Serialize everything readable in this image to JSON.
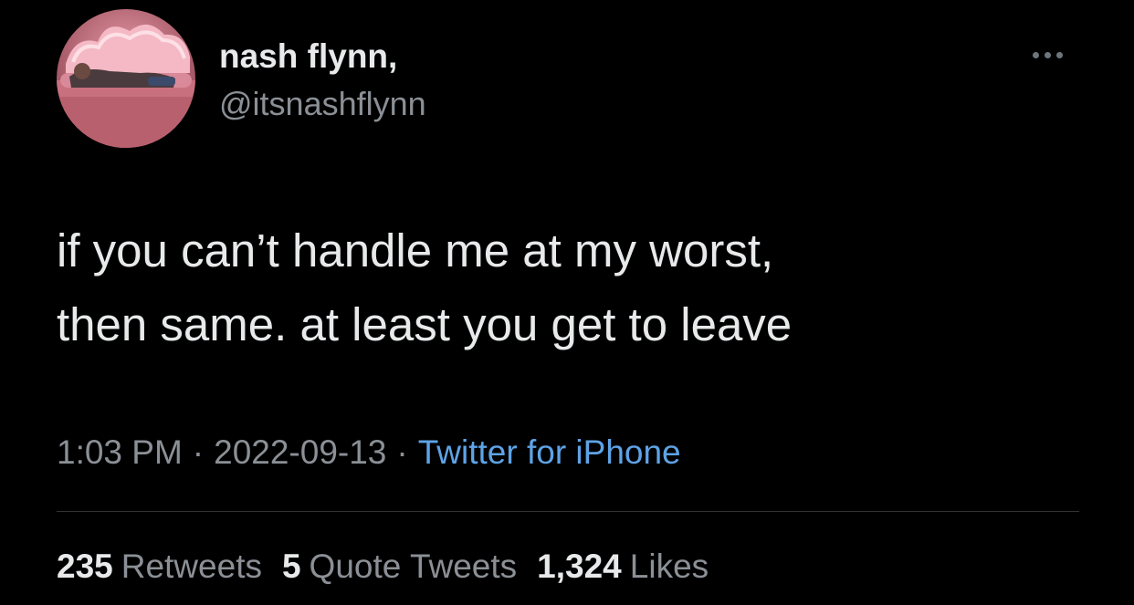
{
  "author": {
    "display_name": "nash flynn,",
    "handle": "@itsnashflynn",
    "avatar_icon": "profile-photo"
  },
  "tweet": {
    "lines": [
      "if you can’t handle me at my worst,",
      "then same. at least you get to leave"
    ]
  },
  "meta": {
    "time": "1:03 PM",
    "separator": "·",
    "date": "2022-09-13",
    "source": "Twitter for iPhone"
  },
  "stats": {
    "retweets_count": "235",
    "retweets_label": "Retweets",
    "quotes_count": "5",
    "quotes_label": "Quote Tweets",
    "likes_count": "1,324",
    "likes_label": "Likes"
  },
  "colors": {
    "background": "#000000",
    "primary_text": "#e7e9ea",
    "secondary_text": "#8b9096",
    "link": "#5ea3e6"
  },
  "icons": {
    "more": "more-horizontal-icon"
  }
}
